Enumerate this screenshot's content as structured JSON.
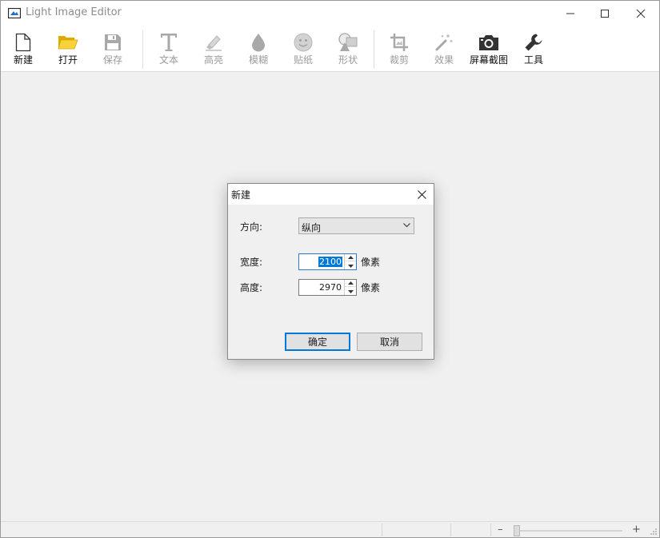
{
  "window": {
    "title": "Light Image Editor"
  },
  "toolbar": {
    "items": [
      {
        "label": "新建",
        "icon": "new-file-icon",
        "enabled": true
      },
      {
        "label": "打开",
        "icon": "folder-open-icon",
        "enabled": true
      },
      {
        "label": "保存",
        "icon": "save-icon",
        "enabled": false
      },
      {
        "label": "文本",
        "icon": "text-icon",
        "enabled": false
      },
      {
        "label": "高亮",
        "icon": "highlighter-icon",
        "enabled": false
      },
      {
        "label": "模糊",
        "icon": "blur-drop-icon",
        "enabled": false
      },
      {
        "label": "贴纸",
        "icon": "sticker-smiley-icon",
        "enabled": false
      },
      {
        "label": "形状",
        "icon": "shapes-icon",
        "enabled": false
      },
      {
        "label": "裁剪",
        "icon": "crop-icon",
        "enabled": false
      },
      {
        "label": "效果",
        "icon": "magic-wand-icon",
        "enabled": false
      },
      {
        "label": "屏幕截图",
        "icon": "camera-icon",
        "enabled": true
      },
      {
        "label": "工具",
        "icon": "wrench-icon",
        "enabled": true
      }
    ]
  },
  "dialog": {
    "title": "新建",
    "orientation_label": "方向:",
    "orientation_value": "纵向",
    "width_label": "宽度:",
    "width_value": "2100",
    "height_label": "高度:",
    "height_value": "2970",
    "unit": "像素",
    "ok_label": "确定",
    "cancel_label": "取消"
  },
  "statusbar": {
    "zoom_minus": "–",
    "zoom_plus": "+"
  },
  "colors": {
    "accent": "#0078d7",
    "folder": "#f5c400",
    "enabled_icon": "#333333",
    "disabled_icon": "#a8a8a8"
  }
}
